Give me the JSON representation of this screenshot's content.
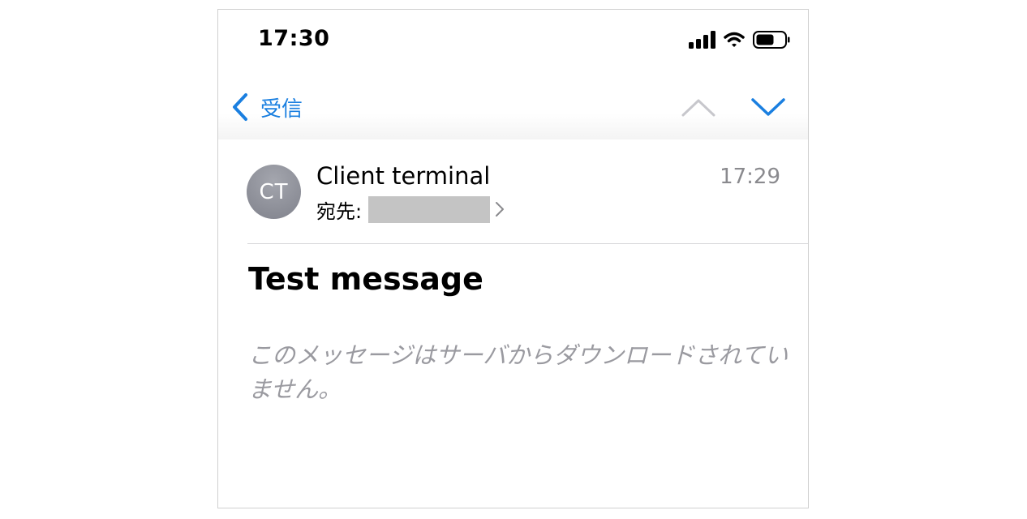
{
  "status_bar": {
    "time": "17:30",
    "icons": [
      "cellular-signal-icon",
      "wifi-icon",
      "battery-icon"
    ]
  },
  "nav": {
    "back_label": "受信",
    "back_icon": "chevron-left-icon",
    "prev_icon": "chevron-up-icon",
    "next_icon": "chevron-down-icon"
  },
  "message": {
    "avatar_initials": "CT",
    "sender": "Client terminal",
    "time": "17:29",
    "recipient_label": "宛先:",
    "subject": "Test message",
    "body": "このメッセージはサーバからダウンロードされていません。"
  },
  "colors": {
    "accent": "#1a7fe0",
    "disabled": "#c7c7cc",
    "secondary_text": "#8a8a8e"
  }
}
